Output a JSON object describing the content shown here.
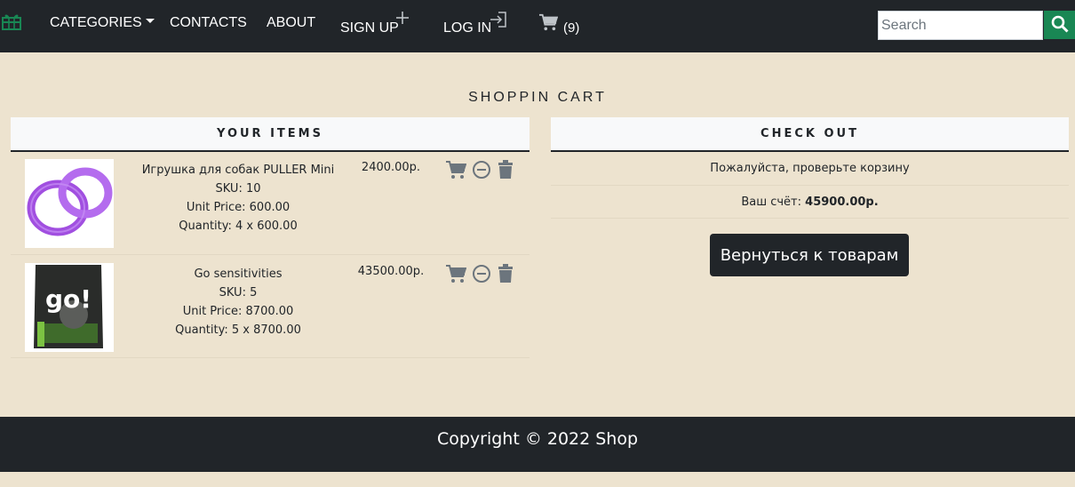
{
  "navbar": {
    "brand_icon": "gift-icon",
    "categories_label": "CATEGORIES",
    "contacts_label": "CONTACTS",
    "about_label": "ABOUT",
    "signup_label": "SIGN UP",
    "login_label": "LOG IN",
    "cart_count": "(9)",
    "search_placeholder": "Search",
    "search_value": "",
    "accent_color": "#198754",
    "bar_color": "#212529"
  },
  "page": {
    "title": "SHOPPIN CART",
    "background": "#ede3cf"
  },
  "items_panel": {
    "header": "YOUR ITEMS",
    "items": [
      {
        "name": "Игрушка для собак PULLER Mini",
        "sku": "SKU: 10",
        "unit_price": "Unit Price: 600.00",
        "quantity": "Quantity: 4 x 600.00",
        "total": "2400.00р.",
        "image": "purple-ring-toy"
      },
      {
        "name": "Go sensitivities",
        "sku": "SKU: 5",
        "unit_price": "Unit Price: 8700.00",
        "quantity": "Quantity: 5 x 8700.00",
        "total": "43500.00р.",
        "image": "go-pet-food-bag",
        "image_text": "go!"
      }
    ],
    "row_icons": [
      "cart-icon",
      "minus-circle-icon",
      "trash-icon"
    ]
  },
  "checkout_panel": {
    "header": "CHECK OUT",
    "note": "Пожалуйста, проверьте корзину",
    "total_label": "Ваш счёт:",
    "total_value": "45900.00р.",
    "back_button": "Вернуться к товарам"
  },
  "footer": {
    "copyright": "Copyright © 2022 Shop"
  }
}
